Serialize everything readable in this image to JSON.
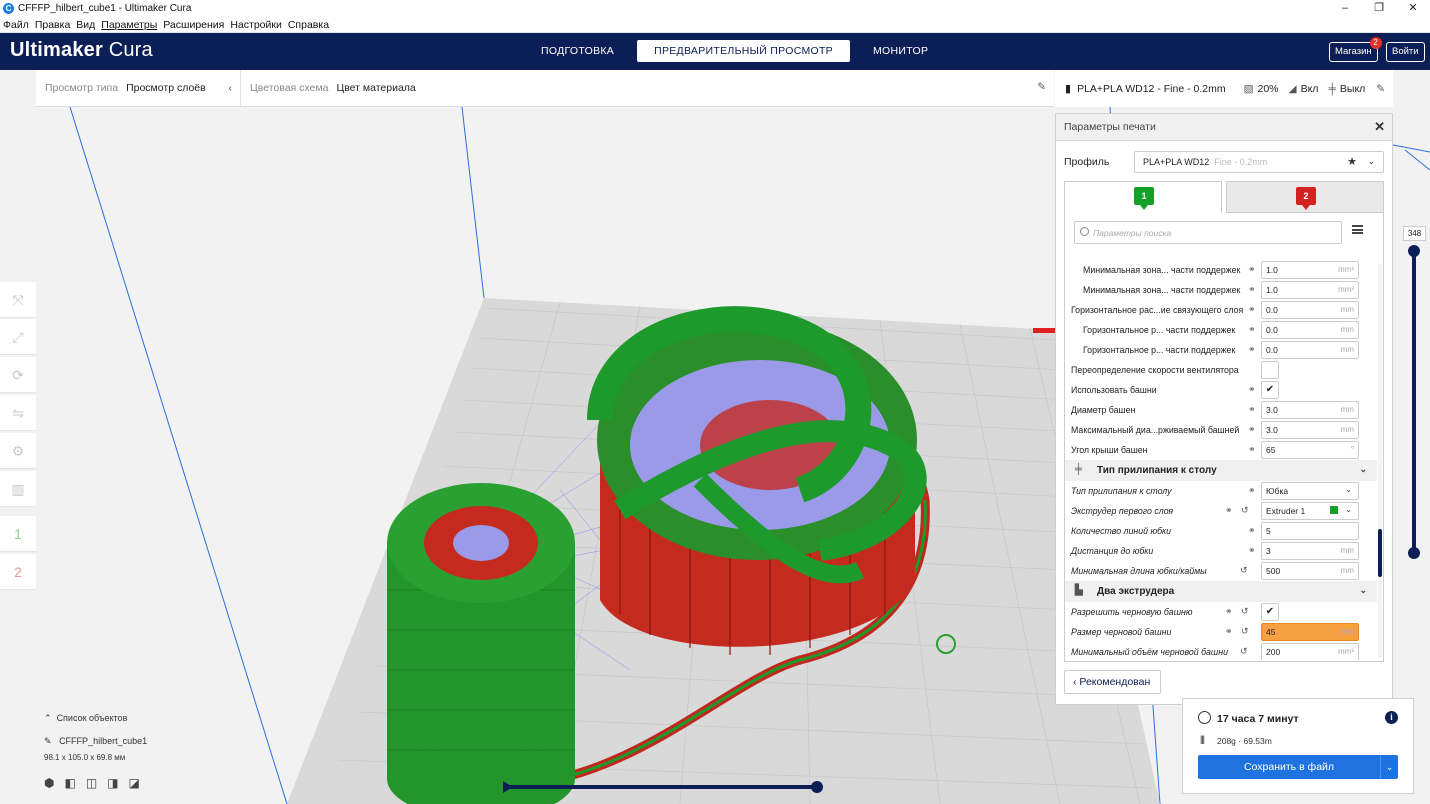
{
  "window": {
    "title": "CFFFP_hilbert_cube1 - Ultimaker Cura",
    "controls": [
      "–",
      "❐",
      "✕"
    ]
  },
  "menu": [
    "Файл",
    "Правка",
    "Вид",
    "Параметры",
    "Расширения",
    "Настройки",
    "Справка"
  ],
  "header": {
    "logo_bold": "Ultimaker",
    "logo_light": " Cura",
    "stages": [
      "ПОДГОТОВКА",
      "ПРЕДВАРИТЕЛЬНЫЙ ПРОСМОТР",
      "МОНИТОР"
    ],
    "active_stage": "ПРЕДВАРИТЕЛЬНЫЙ ПРОСМОТР",
    "marketplace_label": "Магазин",
    "marketplace_badge": "2",
    "login_label": "Войти"
  },
  "viewbar": {
    "view_type_label": "Просмотр типа",
    "view_type_value": "Просмотр слоёв",
    "color_scheme_label": "Цветовая схема",
    "color_scheme_value": "Цвет материала"
  },
  "setup": {
    "profile": "PLA+PLA WD12 - Fine - 0.2mm",
    "infill": "20%",
    "support": "Вкл",
    "adhesion": "Выкл"
  },
  "panel": {
    "title": "Параметры печати",
    "profile_label": "Профиль",
    "profile_value": "PLA+PLA WD12",
    "profile_dim": "Fine - 0.2mm",
    "extruders": [
      "1",
      "2"
    ],
    "search_placeholder": "Параметры поиска",
    "recommended_label": "Рекомендован",
    "rows": [
      {
        "type": "row",
        "name": "Минимальная зона... части поддержек",
        "indent": 1,
        "link": true,
        "value": "1.0",
        "unit": "mm²"
      },
      {
        "type": "row",
        "name": "Минимальная зона... части поддержек",
        "indent": 1,
        "link": true,
        "value": "1.0",
        "unit": "mm²"
      },
      {
        "type": "row",
        "name": "Горизонтальное рас...ие связующего слоя",
        "indent": 0,
        "link": true,
        "value": "0.0",
        "unit": "mm"
      },
      {
        "type": "row",
        "name": "Горизонтальное р... части поддержек",
        "indent": 1,
        "link": true,
        "value": "0.0",
        "unit": "mm"
      },
      {
        "type": "row",
        "name": "Горизонтальное р... части поддержек",
        "indent": 1,
        "link": true,
        "value": "0.0",
        "unit": "mm"
      },
      {
        "type": "check",
        "name": "Переопределение скорости вентилятора",
        "indent": 0,
        "link": false,
        "checked": ""
      },
      {
        "type": "check",
        "name": "Использовать башни",
        "indent": 0,
        "link": true,
        "checked": "✔"
      },
      {
        "type": "row",
        "name": "Диаметр башен",
        "indent": 0,
        "link": true,
        "value": "3.0",
        "unit": "mm"
      },
      {
        "type": "row",
        "name": "Максимальный диа...рживаемый башней",
        "indent": 0,
        "link": true,
        "value": "3.0",
        "unit": "mm"
      },
      {
        "type": "row",
        "name": "Угол крыши башен",
        "indent": 0,
        "link": true,
        "value": "65",
        "unit": "°"
      },
      {
        "type": "cat",
        "name": "Тип прилипания к столу",
        "icon": "╪"
      },
      {
        "type": "select",
        "name": "Тип прилипания к столу",
        "italic": true,
        "link": true,
        "value": "Юбка"
      },
      {
        "type": "select",
        "name": "Экструдер первого слоя",
        "italic": true,
        "link": true,
        "reset": true,
        "value": "Extruder 1"
      },
      {
        "type": "row",
        "name": "Количество линий юбки",
        "italic": true,
        "link": true,
        "value": "5",
        "unit": ""
      },
      {
        "type": "row",
        "name": "Дистанция до юбки",
        "italic": true,
        "link": true,
        "value": "3",
        "unit": "mm"
      },
      {
        "type": "row",
        "name": "Минимальная длина юбки/каймы",
        "italic": true,
        "reset": true,
        "value": "500",
        "unit": "mm"
      },
      {
        "type": "cat",
        "name": "Два экструдера",
        "icon": "▙"
      },
      {
        "type": "check",
        "name": "Разрешить черновую башню",
        "italic": true,
        "link": true,
        "reset": true,
        "checked": "✔"
      },
      {
        "type": "row",
        "name": "Размер черновой башни",
        "italic": true,
        "link": true,
        "reset": true,
        "value": "45",
        "unit": "mm",
        "highlight": true
      },
      {
        "type": "row",
        "name": "Минимальный объём черновой башни",
        "italic": true,
        "reset": true,
        "value": "200",
        "unit": "mm³"
      }
    ]
  },
  "action": {
    "time": "17 часа 7 минут",
    "material": "208g · 69.53m",
    "save_label": "Сохранить в файл"
  },
  "objects": {
    "toggle_label": "Список объектов",
    "file_name": "CFFFP_hilbert_cube1",
    "dimensions": "98.1 x 105.0 x 69.8 мм"
  },
  "layer": {
    "current": "348"
  },
  "colors": {
    "header": "#0c1e56",
    "accent": "#1f73e0",
    "extruder1": "#15a02a",
    "extruder2": "#d42222",
    "highlight": "#f7a043"
  }
}
